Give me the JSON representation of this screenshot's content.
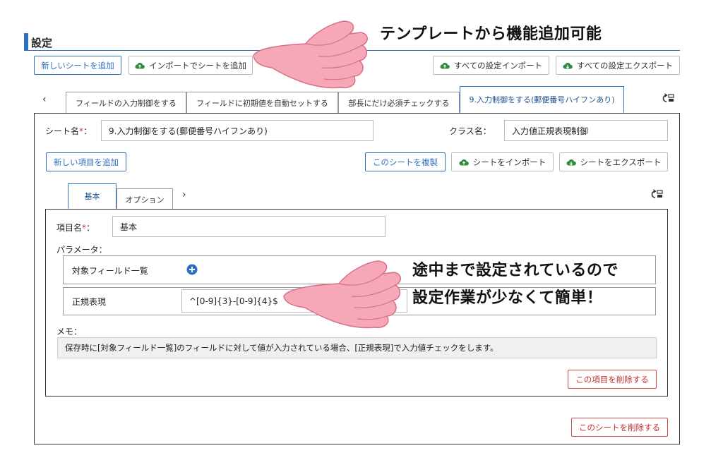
{
  "page": {
    "title": "設定"
  },
  "callouts": {
    "top": "テンプレートから機能追加可能",
    "mid_line1": "途中まで設定されているので",
    "mid_line2": "設定作業が少なくて簡単！"
  },
  "toolbar": {
    "add_sheet": "新しいシートを追加",
    "import_sheet": "インポートでシートを追加",
    "import_all": "すべての設定インポート",
    "export_all": "すべての設定エクスポート"
  },
  "sheet_tabs": [
    {
      "label": "フィールドの入力制御をする"
    },
    {
      "label": "フィールドに初期値を自動セットする"
    },
    {
      "label": "部長にだけ必須チェックする"
    },
    {
      "label": "9.入力制御をする(郵便番号ハイフンあり)"
    }
  ],
  "sheet": {
    "name_label": "シート名",
    "name_value": "9.入力制御をする(郵便番号ハイフンあり)",
    "class_label": "クラス名：",
    "class_value": "入力値正規表現制御",
    "add_item": "新しい項目を追加",
    "duplicate": "このシートを複製",
    "import": "シートをインポート",
    "export": "シートをエクスポート",
    "delete": "このシートを削除する"
  },
  "item_tabs": [
    {
      "label": "基本"
    },
    {
      "label": "オプション"
    }
  ],
  "item": {
    "name_label": "項目名",
    "name_value": "基本",
    "params_label": "パラメータ：",
    "target_fields_label": "対象フィールド一覧",
    "regex_label": "正規表現",
    "regex_value": "^[0-9]{3}-[0-9]{4}$",
    "memo_label": "メモ：",
    "memo_value": "保存時に[対象フィールド一覧]のフィールドに対して値が入力されている場合、[正規表現]で入力値チェックをします。",
    "delete": "この項目を削除する"
  },
  "colors": {
    "accent": "#2f6fc3",
    "danger": "#c03030",
    "success": "#2e8b3e",
    "hand": "#f6a7b8"
  }
}
